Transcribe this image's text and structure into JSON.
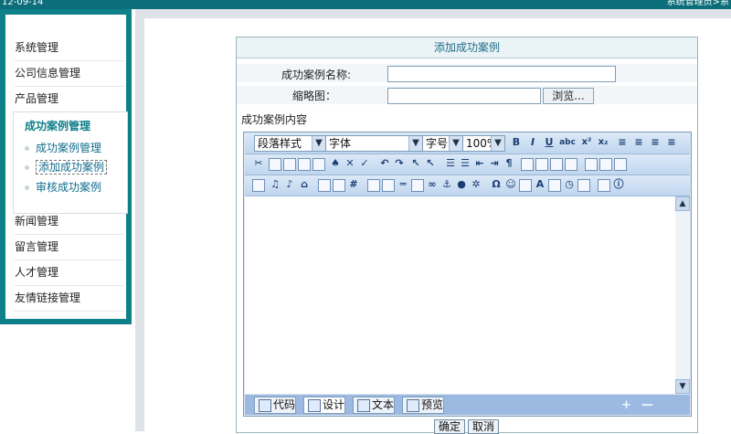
{
  "topbar": {
    "left_text": "12-09-14",
    "right_text": "系统管理员>系"
  },
  "sidebar": {
    "items": [
      {
        "label": "系统管理"
      },
      {
        "label": "公司信息管理"
      },
      {
        "label": "产品管理"
      }
    ],
    "active_group": {
      "title": "成功案例管理",
      "subitems": [
        {
          "label": "成功案例管理"
        },
        {
          "label": "添加成功案例"
        },
        {
          "label": "审核成功案例"
        }
      ]
    },
    "items_after": [
      {
        "label": "新闻管理"
      },
      {
        "label": "留言管理"
      },
      {
        "label": "人才管理"
      },
      {
        "label": "友情链接管理"
      }
    ]
  },
  "form": {
    "title": "添加成功案例",
    "name_label": "成功案例名称:",
    "name_value": "",
    "thumb_label": "缩略图：",
    "thumb_value": "",
    "browse_label": "浏览...",
    "content_label": "成功案例内容"
  },
  "editor": {
    "paragraph_style": "段落样式",
    "font": "字体",
    "font_size": "字号",
    "zoom": "100%",
    "mode_tabs": [
      {
        "label": "代码"
      },
      {
        "label": "设计"
      },
      {
        "label": "文本"
      },
      {
        "label": "预览"
      }
    ],
    "resize_plus": "+",
    "resize_minus": "—",
    "bold": "B",
    "italic": "I",
    "underline": "U",
    "strike": "abc",
    "superscript": "x²",
    "subscript": "x₂"
  },
  "actions": {
    "submit": "确定",
    "cancel": "取消"
  }
}
